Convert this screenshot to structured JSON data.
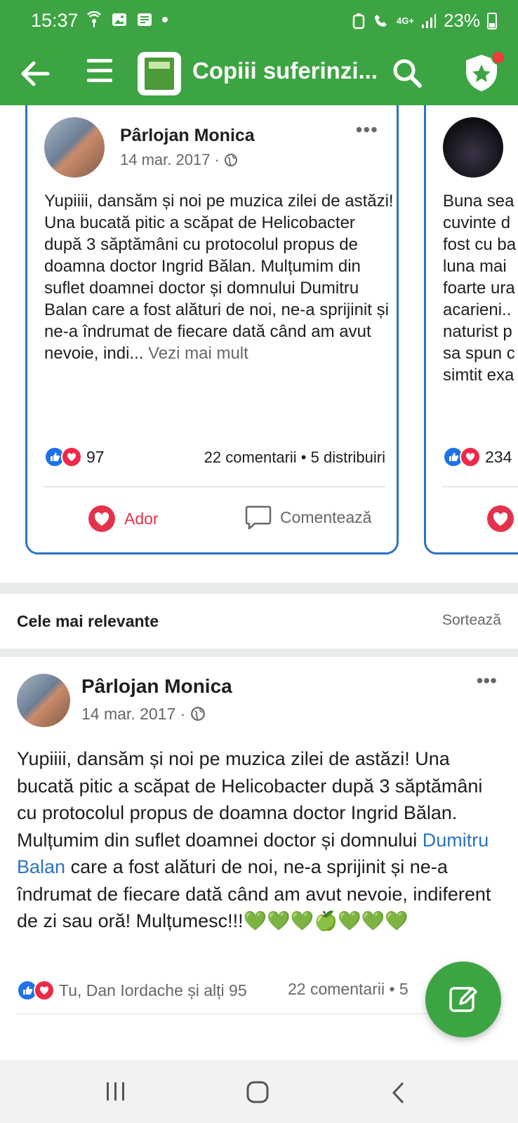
{
  "status_bar": {
    "time": "15:37",
    "network": "4G+",
    "battery": "23%"
  },
  "header": {
    "title": "Copiii suferinzi..."
  },
  "carousel": {
    "main_card": {
      "author": "Pârlojan Monica",
      "date": "14 mar. 2017 ·",
      "text": "Yupiiii, dansăm și noi pe muzica zilei de astăzi! Una bucată pitic a scăpat de Helicobacter după 3 săptămâni cu protocolul propus de doamna doctor Ingrid Bălan. Mulțumim din suflet doamnei doctor și domnului Dumitru Balan care a fost alături de noi, ne-a sprijinit și ne-a îndrumat de fiecare dată când am avut nevoie, indi...",
      "see_more": " Vezi mai mult",
      "reactions": "97",
      "stats": "22 comentarii • 5 distribuiri",
      "love_label": "Ador",
      "comment_label": "Comentează"
    },
    "side_card": {
      "text": "Buna sea cuvinte d fost cu ba luna mai foarte ura acarieni.. naturist p sa spun c simtit exa",
      "reactions": "234"
    }
  },
  "sort": {
    "title": "Cele mai relevante",
    "button": "Sortează"
  },
  "post": {
    "author": "Pârlojan Monica",
    "date": "14 mar. 2017 ·",
    "text_before": "Yupiiii, dansăm și noi pe muzica zilei de astăzi! Una bucată pitic a scăpat de Helicobacter după 3 săptămâni cu protocolul propus de doamna doctor Ingrid Bălan. Mulțumim din suflet doamnei doctor și domnului ",
    "text_link": "Dumitru Balan",
    "text_after": " care a fost alături de noi, ne-a sprijinit și ne-a îndrumat de fiecare dată când am avut nevoie, indiferent de zi sau oră! Mulțumesc!!!",
    "emojis": "💚💚💚🍏💚💚💚",
    "reactions": "Tu, Dan Iordache și alți 95",
    "stats": "22 comentarii • 5"
  },
  "colors": {
    "brand_green": "#3da443",
    "card_border": "#2b73c2",
    "love_red": "#e3334c",
    "link_blue": "#2b73c2"
  },
  "icons": [
    "back-arrow-icon",
    "menu-icon",
    "search-icon",
    "shield-star-icon",
    "globe-icon",
    "like-icon",
    "love-icon",
    "comment-icon",
    "edit-icon"
  ]
}
